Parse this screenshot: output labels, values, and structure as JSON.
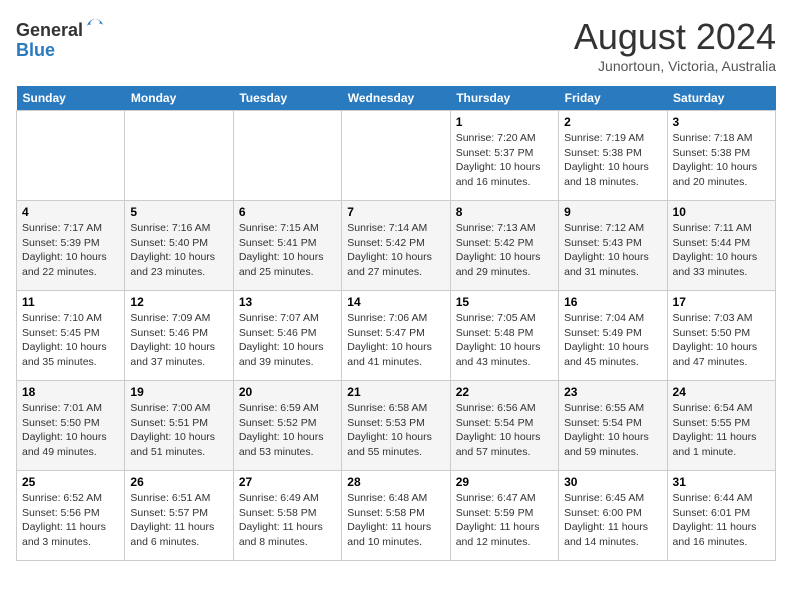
{
  "header": {
    "logo_line1": "General",
    "logo_line2": "Blue",
    "month_title": "August 2024",
    "location": "Junortoun, Victoria, Australia"
  },
  "weekdays": [
    "Sunday",
    "Monday",
    "Tuesday",
    "Wednesday",
    "Thursday",
    "Friday",
    "Saturday"
  ],
  "weeks": [
    [
      {
        "day": "",
        "info": ""
      },
      {
        "day": "",
        "info": ""
      },
      {
        "day": "",
        "info": ""
      },
      {
        "day": "",
        "info": ""
      },
      {
        "day": "1",
        "info": "Sunrise: 7:20 AM\nSunset: 5:37 PM\nDaylight: 10 hours\nand 16 minutes."
      },
      {
        "day": "2",
        "info": "Sunrise: 7:19 AM\nSunset: 5:38 PM\nDaylight: 10 hours\nand 18 minutes."
      },
      {
        "day": "3",
        "info": "Sunrise: 7:18 AM\nSunset: 5:38 PM\nDaylight: 10 hours\nand 20 minutes."
      }
    ],
    [
      {
        "day": "4",
        "info": "Sunrise: 7:17 AM\nSunset: 5:39 PM\nDaylight: 10 hours\nand 22 minutes."
      },
      {
        "day": "5",
        "info": "Sunrise: 7:16 AM\nSunset: 5:40 PM\nDaylight: 10 hours\nand 23 minutes."
      },
      {
        "day": "6",
        "info": "Sunrise: 7:15 AM\nSunset: 5:41 PM\nDaylight: 10 hours\nand 25 minutes."
      },
      {
        "day": "7",
        "info": "Sunrise: 7:14 AM\nSunset: 5:42 PM\nDaylight: 10 hours\nand 27 minutes."
      },
      {
        "day": "8",
        "info": "Sunrise: 7:13 AM\nSunset: 5:42 PM\nDaylight: 10 hours\nand 29 minutes."
      },
      {
        "day": "9",
        "info": "Sunrise: 7:12 AM\nSunset: 5:43 PM\nDaylight: 10 hours\nand 31 minutes."
      },
      {
        "day": "10",
        "info": "Sunrise: 7:11 AM\nSunset: 5:44 PM\nDaylight: 10 hours\nand 33 minutes."
      }
    ],
    [
      {
        "day": "11",
        "info": "Sunrise: 7:10 AM\nSunset: 5:45 PM\nDaylight: 10 hours\nand 35 minutes."
      },
      {
        "day": "12",
        "info": "Sunrise: 7:09 AM\nSunset: 5:46 PM\nDaylight: 10 hours\nand 37 minutes."
      },
      {
        "day": "13",
        "info": "Sunrise: 7:07 AM\nSunset: 5:46 PM\nDaylight: 10 hours\nand 39 minutes."
      },
      {
        "day": "14",
        "info": "Sunrise: 7:06 AM\nSunset: 5:47 PM\nDaylight: 10 hours\nand 41 minutes."
      },
      {
        "day": "15",
        "info": "Sunrise: 7:05 AM\nSunset: 5:48 PM\nDaylight: 10 hours\nand 43 minutes."
      },
      {
        "day": "16",
        "info": "Sunrise: 7:04 AM\nSunset: 5:49 PM\nDaylight: 10 hours\nand 45 minutes."
      },
      {
        "day": "17",
        "info": "Sunrise: 7:03 AM\nSunset: 5:50 PM\nDaylight: 10 hours\nand 47 minutes."
      }
    ],
    [
      {
        "day": "18",
        "info": "Sunrise: 7:01 AM\nSunset: 5:50 PM\nDaylight: 10 hours\nand 49 minutes."
      },
      {
        "day": "19",
        "info": "Sunrise: 7:00 AM\nSunset: 5:51 PM\nDaylight: 10 hours\nand 51 minutes."
      },
      {
        "day": "20",
        "info": "Sunrise: 6:59 AM\nSunset: 5:52 PM\nDaylight: 10 hours\nand 53 minutes."
      },
      {
        "day": "21",
        "info": "Sunrise: 6:58 AM\nSunset: 5:53 PM\nDaylight: 10 hours\nand 55 minutes."
      },
      {
        "day": "22",
        "info": "Sunrise: 6:56 AM\nSunset: 5:54 PM\nDaylight: 10 hours\nand 57 minutes."
      },
      {
        "day": "23",
        "info": "Sunrise: 6:55 AM\nSunset: 5:54 PM\nDaylight: 10 hours\nand 59 minutes."
      },
      {
        "day": "24",
        "info": "Sunrise: 6:54 AM\nSunset: 5:55 PM\nDaylight: 11 hours\nand 1 minute."
      }
    ],
    [
      {
        "day": "25",
        "info": "Sunrise: 6:52 AM\nSunset: 5:56 PM\nDaylight: 11 hours\nand 3 minutes."
      },
      {
        "day": "26",
        "info": "Sunrise: 6:51 AM\nSunset: 5:57 PM\nDaylight: 11 hours\nand 6 minutes."
      },
      {
        "day": "27",
        "info": "Sunrise: 6:49 AM\nSunset: 5:58 PM\nDaylight: 11 hours\nand 8 minutes."
      },
      {
        "day": "28",
        "info": "Sunrise: 6:48 AM\nSunset: 5:58 PM\nDaylight: 11 hours\nand 10 minutes."
      },
      {
        "day": "29",
        "info": "Sunrise: 6:47 AM\nSunset: 5:59 PM\nDaylight: 11 hours\nand 12 minutes."
      },
      {
        "day": "30",
        "info": "Sunrise: 6:45 AM\nSunset: 6:00 PM\nDaylight: 11 hours\nand 14 minutes."
      },
      {
        "day": "31",
        "info": "Sunrise: 6:44 AM\nSunset: 6:01 PM\nDaylight: 11 hours\nand 16 minutes."
      }
    ]
  ]
}
